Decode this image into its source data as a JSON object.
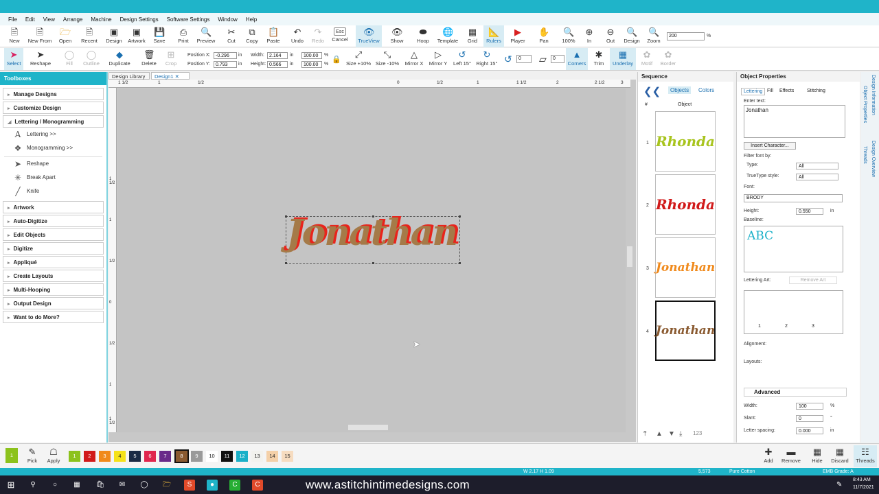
{
  "menu": [
    "File",
    "Edit",
    "View",
    "Arrange",
    "Machine",
    "Design Settings",
    "Software Settings",
    "Window",
    "Help"
  ],
  "toolbar1": [
    "New",
    "New From",
    "Open",
    "Recent",
    "Design",
    "Artwork",
    "Save",
    "Print",
    "Preview",
    "Cut",
    "Copy",
    "Paste",
    "Undo",
    "Redo",
    "Cancel",
    "TrueView",
    "Show",
    "Hoop",
    "Template",
    "Grid",
    "Rulers",
    "Player",
    "Pan",
    "100%",
    "In",
    "Out",
    "Design",
    "Zoom"
  ],
  "toolbar1_icons": [
    "new-icon",
    "new-from-icon",
    "open-icon",
    "recent-icon",
    "design-icon",
    "artwork-icon",
    "save-icon",
    "print-icon",
    "preview-icon",
    "cut-icon",
    "copy-icon",
    "paste-icon",
    "undo-icon",
    "redo-icon",
    "esc-icon",
    "trueview-icon",
    "show-icon",
    "hoop-icon",
    "template-icon",
    "grid-icon",
    "rulers-icon",
    "player-icon",
    "pan-icon",
    "zoom-100-icon",
    "zoom-in-icon",
    "zoom-out-icon",
    "zoom-design-icon",
    "zoom-icon"
  ],
  "esc_label": "Esc",
  "zoom_value": "200",
  "zoom_unit": "%",
  "toolbar2": {
    "select": "Select",
    "reshape": "Reshape",
    "fill": "Fill",
    "outline": "Outline",
    "duplicate": "Duplicate",
    "delete": "Delete",
    "crop": "Crop",
    "size_plus": "Size +10%",
    "size_minus": "Size -10%",
    "mirror_x": "Mirror X",
    "mirror_y": "Mirror Y",
    "left15": "Left 15°",
    "right15": "Right 15°",
    "rotate_value": "0",
    "angle_value": "0",
    "corners": "Corners",
    "trim": "Trim",
    "underlay": "Underlay",
    "motif": "Motif",
    "border": "Border"
  },
  "position": {
    "x_label": "Position X:",
    "y_label": "Position Y:",
    "x": "-0.296",
    "y": "0.793",
    "unit": "in"
  },
  "size": {
    "w_label": "Width:",
    "h_label": "Height:",
    "w": "2.164",
    "h": "0.566",
    "unit": "in",
    "wp": "100.00",
    "hp": "100.00",
    "pct": "%"
  },
  "toolboxes": {
    "title": "Toolboxes",
    "groups": [
      "Manage Designs",
      "Customize Design",
      "Lettering / Monogramming"
    ],
    "lettering_items": [
      "Lettering >>",
      "Monogramming >>"
    ],
    "tools": [
      "Reshape",
      "Break Apart",
      "Knife"
    ],
    "more_groups": [
      "Artwork",
      "Auto-Digitize",
      "Edit Objects",
      "Digitize",
      "Appliqué",
      "Create Layouts",
      "Multi-Hooping",
      "Output Design",
      "Want to do More?"
    ]
  },
  "doc_tabs": [
    "Design Library",
    "Design1"
  ],
  "ruler_h": [
    "1 1/2",
    "1",
    "1/2",
    "0",
    "1/2",
    "1",
    "1 1/2",
    "2",
    "2 1/2",
    "3"
  ],
  "ruler_v": [
    "1 1/2",
    "1",
    "1/2",
    "0",
    "1/2",
    "1",
    "1 1/2"
  ],
  "design_text": "Jonathan",
  "sequence": {
    "title": "Sequence",
    "tab_objects": "Objects",
    "tab_colors": "Colors",
    "col_num": "#",
    "col_obj": "Object",
    "items": [
      {
        "num": "1",
        "text": "Rhonda",
        "color": "#a8c41e"
      },
      {
        "num": "2",
        "text": "Rhonda",
        "color": "#d11a1a"
      },
      {
        "num": "3",
        "text": "Jonathan",
        "color": "#f08a1c"
      },
      {
        "num": "4",
        "text": "Jonathan",
        "color": "#8a5a30"
      }
    ],
    "sort_label": "123"
  },
  "props": {
    "title": "Object Properties",
    "tabs": [
      "Lettering",
      "Fill",
      "Effects",
      "Stitching"
    ],
    "enter_text_label": "Enter text:",
    "text": "Jonathan",
    "insert_char": "Insert Character...",
    "filter_label": "Filter font by:",
    "type_label": "Type:",
    "type_val": "All",
    "tt_label": "TrueType style:",
    "tt_val": "All",
    "font_label": "Font:",
    "font_val": "BRODY",
    "height_label": "Height:",
    "height_val": "0.550",
    "height_unit": "in",
    "baseline_label": "Baseline:",
    "baseline_abc": "ABC",
    "art_label": "Lettering Art:",
    "remove_art": "Remove Art",
    "art_items": [
      "1",
      "2",
      "3"
    ],
    "alignment_label": "Alignment:",
    "layouts_label": "Layouts:",
    "advanced": "Advanced",
    "width_label": "Width:",
    "width_val": "100",
    "width_unit": "%",
    "slant_label": "Slant:",
    "slant_val": "0",
    "slant_unit": "°",
    "spacing_label": "Letter spacing:",
    "spacing_val": "0.000",
    "spacing_unit": "in"
  },
  "side_tabs": [
    "Design Information",
    "Object Properties",
    "Threads",
    "Design Overview"
  ],
  "swatches": {
    "pick": "Pick",
    "apply": "Apply",
    "colors": [
      {
        "n": "1",
        "c": "#8cc21c"
      },
      {
        "n": "2",
        "c": "#d11a1a"
      },
      {
        "n": "3",
        "c": "#f08a1c"
      },
      {
        "n": "4",
        "c": "#f5e21a"
      },
      {
        "n": "5",
        "c": "#1b2b45"
      },
      {
        "n": "6",
        "c": "#e0264d"
      },
      {
        "n": "7",
        "c": "#6a2a8a"
      },
      {
        "n": "8",
        "c": "#8a5a30"
      },
      {
        "n": "9",
        "c": "#9a9a9a"
      },
      {
        "n": "10",
        "c": "#ffffff"
      },
      {
        "n": "11",
        "c": "#111111"
      },
      {
        "n": "12",
        "c": "#1ab0c8"
      },
      {
        "n": "13",
        "c": "#f2f2ee"
      },
      {
        "n": "14",
        "c": "#f4d0a8"
      },
      {
        "n": "15",
        "c": "#f6dcc0"
      }
    ],
    "actions": [
      "Add",
      "Remove",
      "Hide",
      "Discard",
      "Threads"
    ]
  },
  "status": {
    "dims": "W 2.17 H 1.09",
    "stitches": "5,573",
    "thread": "Pure Cotton",
    "grade": "EMB Grade: A"
  },
  "taskbar": {
    "website": "www.astitchintimedesigns.com",
    "time": "8:43 AM",
    "date": "11/7/2021"
  }
}
